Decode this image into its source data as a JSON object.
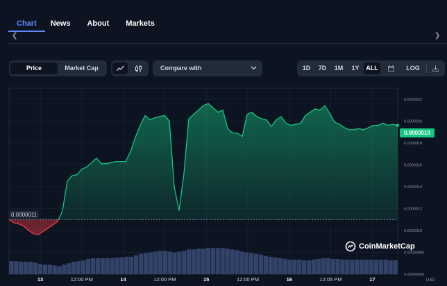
{
  "tabs": [
    {
      "label": "Chart",
      "active": true
    },
    {
      "label": "News",
      "active": false
    },
    {
      "label": "About",
      "active": false
    },
    {
      "label": "Markets",
      "active": false
    }
  ],
  "toolbar": {
    "mode_buttons": [
      "Price",
      "Market Cap"
    ],
    "active_mode": "Price",
    "chart_type_icons": [
      "line-chart-icon",
      "candlestick-icon"
    ],
    "compare_label": "Compare with",
    "ranges": [
      "1D",
      "7D",
      "1M",
      "1Y",
      "ALL"
    ],
    "active_range": "ALL",
    "log_label": "LOG"
  },
  "colors": {
    "background": "#0d1421",
    "accent": "#6188ff",
    "up": "#16c784",
    "down": "#ea3943",
    "volume": "#3b4a74"
  },
  "chart": {
    "current_price_label": "0.0000019",
    "low_label": "0.0000011",
    "currency": "USD",
    "watermark": "CoinMarketCap",
    "y_ticks": [
      "0.0000022",
      "0.0000020",
      "0.0000018",
      "0.0000016",
      "0.0000014",
      "0.0000012",
      "0.0000010",
      "0.00000080",
      "0.00000060"
    ],
    "x_ticks": [
      {
        "label": "13",
        "bold": true
      },
      {
        "label": "12:00 PM",
        "bold": false
      },
      {
        "label": "14",
        "bold": true
      },
      {
        "label": "12:00 PM",
        "bold": false
      },
      {
        "label": "15",
        "bold": true
      },
      {
        "label": "12:00 PM",
        "bold": false
      },
      {
        "label": "16",
        "bold": true
      },
      {
        "label": "12:05 PM",
        "bold": false
      },
      {
        "label": "17",
        "bold": true
      }
    ]
  },
  "chart_data": {
    "type": "line",
    "baseline": 1.1e-06,
    "ylim": [
      6e-07,
      2.3e-06
    ],
    "x": [
      0,
      1,
      2,
      3,
      4,
      5,
      6,
      7,
      8,
      9,
      10,
      11,
      12,
      13,
      14,
      15,
      16,
      17,
      18,
      19,
      20,
      21,
      22,
      23,
      24,
      25,
      26,
      27,
      28,
      29,
      30,
      31,
      32,
      33,
      34,
      35,
      36,
      37,
      38,
      39,
      40,
      41,
      42,
      43,
      44,
      45,
      46,
      47,
      48,
      49,
      50,
      51,
      52,
      53,
      54,
      55,
      56,
      57,
      58,
      59,
      60,
      61,
      62,
      63,
      64,
      65,
      66,
      67,
      68,
      69,
      70,
      71,
      72,
      73,
      74,
      75,
      76,
      77,
      78,
      79,
      80
    ],
    "values": [
      1.1e-06,
      1.07e-06,
      1.06e-06,
      1.04e-06,
      1e-06,
      9.7e-07,
      9.6e-07,
      9.9e-07,
      1.02e-06,
      1.05e-06,
      1.08e-06,
      1.18e-06,
      1.45e-06,
      1.5e-06,
      1.51e-06,
      1.56e-06,
      1.58e-06,
      1.62e-06,
      1.66e-06,
      1.61e-06,
      1.61e-06,
      1.62e-06,
      1.63e-06,
      1.63e-06,
      1.63e-06,
      1.72e-06,
      1.85e-06,
      1.96e-06,
      2.05e-06,
      2.01e-06,
      2.03e-06,
      2.04e-06,
      2.05e-06,
      2e-06,
      1.4e-06,
      1.18e-06,
      1.52e-06,
      2.02e-06,
      2.06e-06,
      2.1e-06,
      2.14e-06,
      2.16e-06,
      2.12e-06,
      2.08e-06,
      2.1e-06,
      1.93e-06,
      1.89e-06,
      1.89e-06,
      1.86e-06,
      2.06e-06,
      2.08e-06,
      2.04e-06,
      2.02e-06,
      2.01e-06,
      1.95e-06,
      2.01e-06,
      2.04e-06,
      1.98e-06,
      1.96e-06,
      1.97e-06,
      1.98e-06,
      2.05e-06,
      2.08e-06,
      2.11e-06,
      2.1e-06,
      2.14e-06,
      2.07e-06,
      1.99e-06,
      1.97e-06,
      1.94e-06,
      1.92e-06,
      1.92e-06,
      1.93e-06,
      1.92e-06,
      1.94e-06,
      1.96e-06,
      1.96e-06,
      1.98e-06,
      1.96e-06,
      1.97e-06,
      1.96e-06
    ],
    "volume": [
      18,
      18,
      17,
      17,
      17,
      16,
      14,
      13,
      13,
      12,
      11,
      13,
      15,
      17,
      18,
      19,
      21,
      22,
      22,
      22,
      22,
      22,
      23,
      23,
      24,
      24,
      26,
      28,
      29,
      30,
      31,
      32,
      32,
      31,
      30,
      31,
      32,
      34,
      34,
      35,
      35,
      36,
      36,
      36,
      36,
      35,
      34,
      33,
      31,
      30,
      29,
      28,
      27,
      25,
      24,
      23,
      22,
      21,
      20,
      20,
      20,
      19,
      19,
      20,
      21,
      22,
      22,
      21,
      21,
      20,
      20,
      20,
      20,
      20,
      20,
      20,
      20,
      20,
      20,
      19,
      19
    ]
  }
}
